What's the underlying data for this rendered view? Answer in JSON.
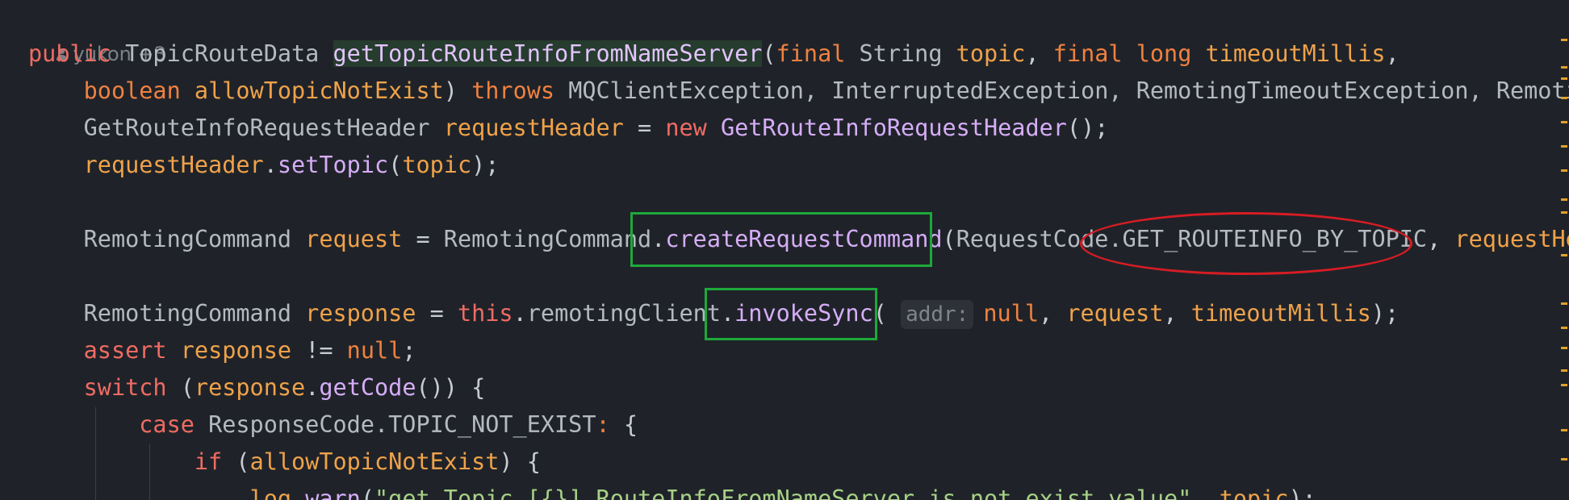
{
  "author_annotation": "yukon +3",
  "lines": [
    {
      "segments": [
        {
          "c": "kw2",
          "t": "public "
        },
        {
          "c": "typ",
          "t": "TopicRouteData "
        },
        {
          "c": "fnh",
          "t": "getTopicRouteInfoFromNameServer"
        },
        {
          "c": "punc",
          "t": "("
        },
        {
          "c": "kw",
          "t": "final "
        },
        {
          "c": "typ",
          "t": "String "
        },
        {
          "c": "var",
          "t": "topic"
        },
        {
          "c": "punc",
          "t": ", "
        },
        {
          "c": "kw",
          "t": "final "
        },
        {
          "c": "kw",
          "t": "long "
        },
        {
          "c": "var",
          "t": "timeoutMillis"
        },
        {
          "c": "punc",
          "t": ","
        }
      ]
    },
    {
      "segments": [
        {
          "c": "kw",
          "t": "    boolean "
        },
        {
          "c": "var",
          "t": "allowTopicNotExist"
        },
        {
          "c": "punc",
          "t": ") "
        },
        {
          "c": "kw",
          "t": "throws "
        },
        {
          "c": "typ",
          "t": "MQClientException, InterruptedException, RemotingTimeoutException, Remoting"
        }
      ]
    },
    {
      "segments": [
        {
          "c": "typ",
          "t": "    GetRouteInfoRequestHeader "
        },
        {
          "c": "var",
          "t": "requestHeader "
        },
        {
          "c": "punc",
          "t": "= "
        },
        {
          "c": "kw2",
          "t": "new "
        },
        {
          "c": "fn",
          "t": "GetRouteInfoRequestHeader"
        },
        {
          "c": "punc",
          "t": "();"
        }
      ]
    },
    {
      "segments": [
        {
          "c": "var",
          "t": "    requestHeader"
        },
        {
          "c": "punc",
          "t": "."
        },
        {
          "c": "fn",
          "t": "setTopic"
        },
        {
          "c": "punc",
          "t": "("
        },
        {
          "c": "var",
          "t": "topic"
        },
        {
          "c": "punc",
          "t": ");"
        }
      ]
    },
    {
      "segments": []
    },
    {
      "segments": [
        {
          "c": "typ",
          "t": "    RemotingCommand "
        },
        {
          "c": "var",
          "t": "request "
        },
        {
          "c": "punc",
          "t": "= "
        },
        {
          "c": "typ",
          "t": "RemotingCommand"
        },
        {
          "c": "punc",
          "t": "."
        },
        {
          "c": "fn",
          "t": "createRequestCommand"
        },
        {
          "c": "punc",
          "t": "("
        },
        {
          "c": "typ",
          "t": "RequestCode.GET_ROUTEINFO_BY_TOPIC"
        },
        {
          "c": "punc",
          "t": ", "
        },
        {
          "c": "var",
          "t": "requestHeader"
        }
      ]
    },
    {
      "segments": []
    },
    {
      "segments": [
        {
          "c": "typ",
          "t": "    RemotingCommand "
        },
        {
          "c": "var",
          "t": "response "
        },
        {
          "c": "punc",
          "t": "= "
        },
        {
          "c": "kw2",
          "t": "this"
        },
        {
          "c": "punc",
          "t": "."
        },
        {
          "c": "typ",
          "t": "remotingClient"
        },
        {
          "c": "punc",
          "t": "."
        },
        {
          "c": "fn",
          "t": "invokeSync"
        },
        {
          "c": "punc",
          "t": "( "
        },
        {
          "c": "hint",
          "t": "addr:"
        },
        {
          "c": "kw",
          "t": "null"
        },
        {
          "c": "punc",
          "t": ", "
        },
        {
          "c": "var",
          "t": "request"
        },
        {
          "c": "punc",
          "t": ", "
        },
        {
          "c": "var",
          "t": "timeoutMillis"
        },
        {
          "c": "punc",
          "t": ");"
        }
      ]
    },
    {
      "segments": [
        {
          "c": "kw2",
          "t": "    assert "
        },
        {
          "c": "var",
          "t": "response "
        },
        {
          "c": "punc",
          "t": "!= "
        },
        {
          "c": "kw",
          "t": "null"
        },
        {
          "c": "punc",
          "t": ";"
        }
      ]
    },
    {
      "segments": [
        {
          "c": "kw2",
          "t": "    switch "
        },
        {
          "c": "punc",
          "t": "("
        },
        {
          "c": "var",
          "t": "response"
        },
        {
          "c": "punc",
          "t": "."
        },
        {
          "c": "fn",
          "t": "getCode"
        },
        {
          "c": "punc",
          "t": "()) {"
        }
      ]
    },
    {
      "segments": [
        {
          "c": "kw2",
          "t": "        case "
        },
        {
          "c": "typ",
          "t": "ResponseCode.TOPIC_NOT_EXIST"
        },
        {
          "c": "kw",
          "t": ": "
        },
        {
          "c": "punc",
          "t": "{"
        }
      ]
    },
    {
      "segments": [
        {
          "c": "kw2",
          "t": "            if "
        },
        {
          "c": "punc",
          "t": "("
        },
        {
          "c": "var",
          "t": "allowTopicNotExist"
        },
        {
          "c": "punc",
          "t": ") {"
        }
      ]
    },
    {
      "segments": [
        {
          "c": "var",
          "t": "                log"
        },
        {
          "c": "punc",
          "t": "."
        },
        {
          "c": "fn",
          "t": "warn"
        },
        {
          "c": "punc",
          "t": "("
        },
        {
          "c": "str",
          "t": "\"get Topic [{}] RouteInfoFromNameServer is not exist value\""
        },
        {
          "c": "punc",
          "t": ", "
        },
        {
          "c": "var",
          "t": "topic"
        },
        {
          "c": "punc",
          "t": ");"
        }
      ]
    }
  ],
  "colors": {
    "background": "#1f2329",
    "annotation_box": "#1ea83a",
    "annotation_ellipse": "#d71c24",
    "scroll_marker": "#e0a02a"
  }
}
